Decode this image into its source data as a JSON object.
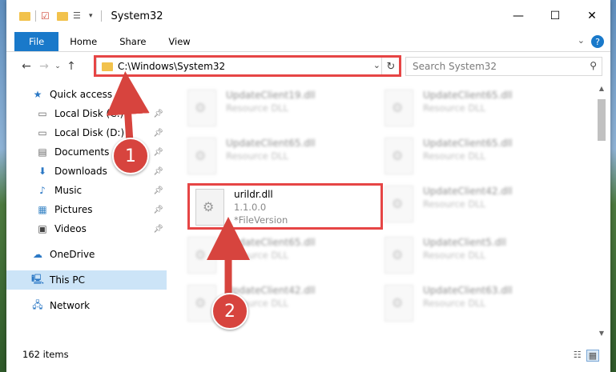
{
  "window": {
    "title": "System32"
  },
  "ribbon": {
    "tabs": [
      "File",
      "Home",
      "Share",
      "View"
    ],
    "help": "?"
  },
  "address": {
    "path": "C:\\Windows\\System32"
  },
  "search": {
    "placeholder": "Search System32"
  },
  "sidebar": {
    "items": [
      {
        "label": "Quick access",
        "icon": "star-icon",
        "pinned": false
      },
      {
        "label": "Local Disk (C:)",
        "icon": "drive-icon",
        "pinned": true
      },
      {
        "label": "Local Disk (D:)",
        "icon": "drive-icon",
        "pinned": true
      },
      {
        "label": "Documents",
        "icon": "documents-icon",
        "pinned": true
      },
      {
        "label": "Downloads",
        "icon": "download-icon",
        "pinned": true
      },
      {
        "label": "Music",
        "icon": "music-icon",
        "pinned": true
      },
      {
        "label": "Pictures",
        "icon": "pictures-icon",
        "pinned": true
      },
      {
        "label": "Videos",
        "icon": "videos-icon",
        "pinned": true
      },
      {
        "label": "OneDrive",
        "icon": "cloud-icon",
        "pinned": false
      },
      {
        "label": "This PC",
        "icon": "computer-icon",
        "pinned": false
      },
      {
        "label": "Network",
        "icon": "network-icon",
        "pinned": false
      }
    ]
  },
  "files": [
    {
      "name": "UpdateClient19.dll",
      "line2": "Resource DLL",
      "line3": ""
    },
    {
      "name": "UpdateClient65.dll",
      "line2": "Resource DLL",
      "line3": ""
    },
    {
      "name": "UpdateClient65.dll",
      "line2": "Resource DLL",
      "line3": ""
    },
    {
      "name": "UpdateClient65.dll",
      "line2": "Resource DLL",
      "line3": ""
    },
    {
      "name": "urildr.dll",
      "line2": "1.1.0.0",
      "line3": "*FileVersion"
    },
    {
      "name": "UpdateClient42.dll",
      "line2": "Resource DLL",
      "line3": ""
    },
    {
      "name": "UpdateClient65.dll",
      "line2": "Resource DLL",
      "line3": ""
    },
    {
      "name": "UpdateClient5.dll",
      "line2": "Resource DLL",
      "line3": ""
    },
    {
      "name": "UpdateClient42.dll",
      "line2": "Resource DLL",
      "line3": ""
    },
    {
      "name": "UpdateClient63.dll",
      "line2": "Resource DLL",
      "line3": ""
    }
  ],
  "status": {
    "count": "162 items"
  },
  "annotations": {
    "step1": "1",
    "step2": "2",
    "color": "#d7443e"
  }
}
